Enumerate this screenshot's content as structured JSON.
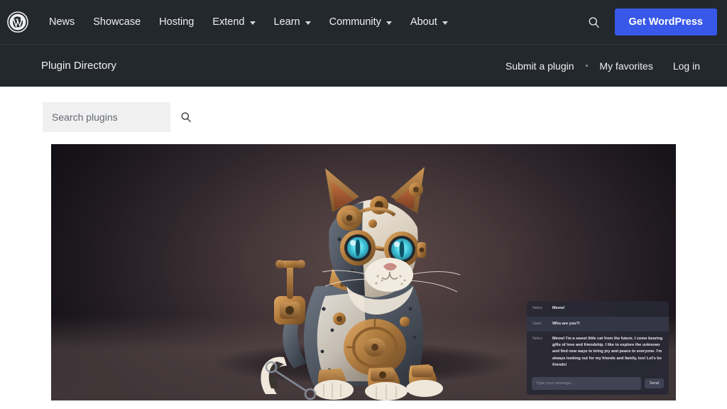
{
  "masthead": {
    "logo_icon": "wordpress-logo-icon",
    "nav": [
      {
        "label": "News",
        "has_caret": false
      },
      {
        "label": "Showcase",
        "has_caret": false
      },
      {
        "label": "Hosting",
        "has_caret": false
      },
      {
        "label": "Extend",
        "has_caret": true
      },
      {
        "label": "Learn",
        "has_caret": true
      },
      {
        "label": "Community",
        "has_caret": true
      },
      {
        "label": "About",
        "has_caret": true
      }
    ],
    "search_icon": "search-icon",
    "cta_label": "Get WordPress",
    "cta_color": "#3858e9",
    "background": "#23282d"
  },
  "subbar": {
    "title": "Plugin Directory",
    "links": [
      {
        "label": "Submit a plugin"
      },
      {
        "label": "My favorites"
      },
      {
        "label": "Log in"
      }
    ],
    "separator": "•"
  },
  "search": {
    "value": "",
    "placeholder": "Search plugins",
    "icon": "search-icon"
  },
  "hero": {
    "alt": "Steampunk robotic cat with glowing cyan goggle eyes and brass mechanical parts",
    "background_color": "#141217"
  },
  "chat": {
    "messages": [
      {
        "speaker": "Neko:",
        "text": "Meow!"
      },
      {
        "speaker": "User:",
        "text": "Who are you?!"
      },
      {
        "speaker": "Neko:",
        "text": "Meow! I'm a sweet little cat from the future. I come bearing gifts of love and friendship. I like to explore the unknown and find new ways to bring joy and peace to everyone. I'm always looking out for my friends and family, too! Let's be friends!"
      }
    ],
    "input_value": "",
    "input_placeholder": "Type your message...",
    "send_label": "Send"
  }
}
